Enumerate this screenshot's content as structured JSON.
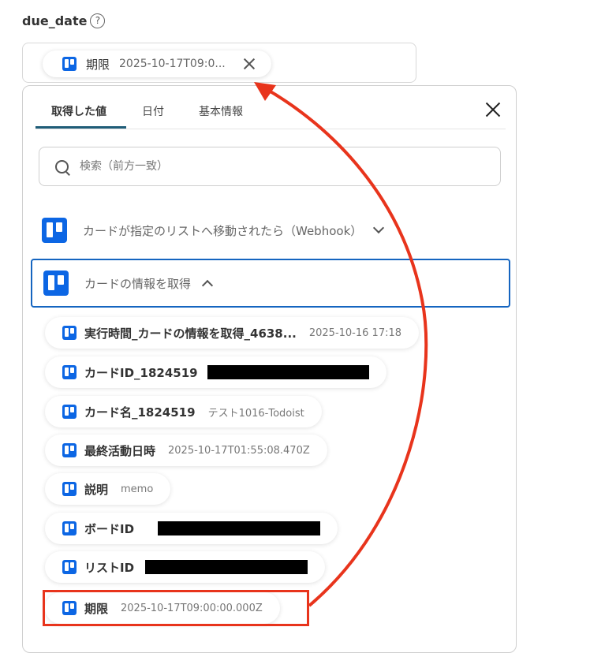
{
  "field": {
    "label": "due_date",
    "help": "?",
    "chip_title": "期限",
    "chip_value": "2025-10-17T09:0..."
  },
  "popup": {
    "tabs": [
      {
        "label": "取得した値"
      },
      {
        "label": "日付"
      },
      {
        "label": "基本情報"
      }
    ],
    "search_placeholder": "検索（前方一致）",
    "sections": [
      {
        "label": "カードが指定のリストへ移動されたら（Webhook）",
        "expanded": false
      },
      {
        "label": "カードの情報を取得",
        "expanded": true
      }
    ],
    "items": [
      {
        "title": "実行時間_カードの情報を取得_4638...",
        "value": "2025-10-16 17:18"
      },
      {
        "title": "カードID_1824519",
        "value": ""
      },
      {
        "title": "カード名_1824519",
        "value": "テスト1016-Todoist"
      },
      {
        "title": "最終活動日時",
        "value": "2025-10-17T01:55:08.470Z"
      },
      {
        "title": "説明",
        "value": "memo"
      },
      {
        "title": "ボードID",
        "value": ""
      },
      {
        "title": "リストID",
        "value": ""
      },
      {
        "title": "期限",
        "value": "2025-10-17T09:00:00.000Z"
      }
    ]
  },
  "colors": {
    "trello_blue": "#0c66e4",
    "active_border": "#1565c0",
    "annotation_red": "#e8341c",
    "tab_underline": "#1f5d78"
  }
}
